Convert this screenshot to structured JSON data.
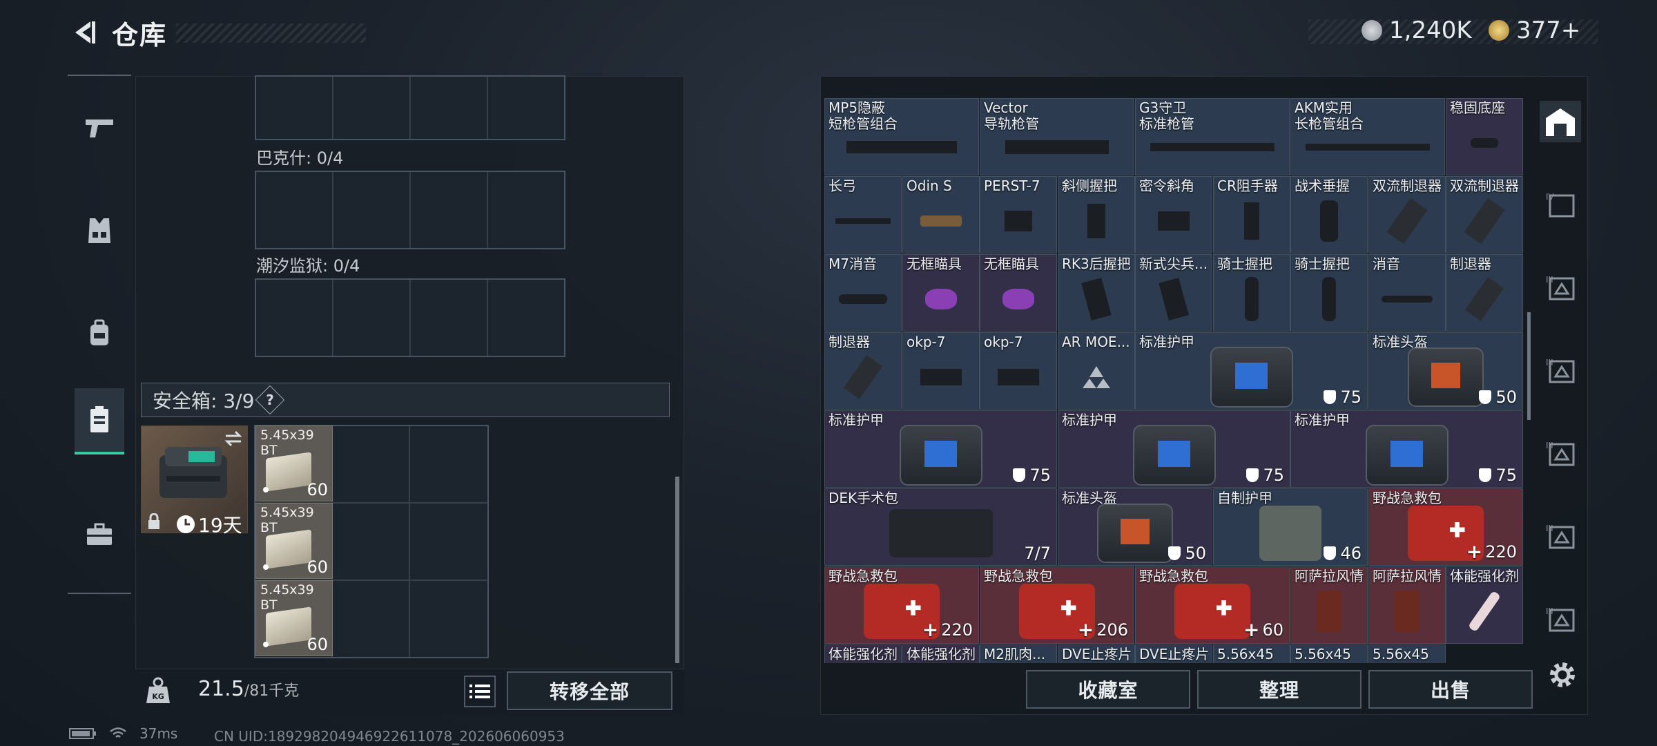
{
  "header": {
    "title": "仓库",
    "currency1": "1,240K",
    "currency2": "377+"
  },
  "left": {
    "slots": [
      {
        "label": "巴克什: 0/4"
      },
      {
        "label": "潮汐监狱: 0/4"
      }
    ],
    "safe_box": {
      "label": "安全箱: 3/9",
      "help": "?",
      "duration": "19天"
    },
    "ammo": [
      {
        "name": "5.45x39",
        "sub": "BT",
        "qty": "60"
      },
      {
        "name": "5.45x39",
        "sub": "BT",
        "qty": "60"
      },
      {
        "name": "5.45x39",
        "sub": "BT",
        "qty": "60"
      }
    ],
    "weight": {
      "current": "21.5",
      "max": "/81千克"
    },
    "transfer_all": "转移全部"
  },
  "inventory": {
    "row1": [
      {
        "l1": "MP5隐蔽",
        "l2": "短枪管组合"
      },
      {
        "l1": "Vector",
        "l2": "导轨枪管"
      },
      {
        "l1": "G3守卫",
        "l2": "标准枪管"
      },
      {
        "l1": "AKM实用",
        "l2": "长枪管组合"
      },
      {
        "l1": "稳固底座",
        "l2": ""
      }
    ],
    "row2": [
      "长弓",
      "Odin S",
      "PERST-7",
      "斜侧握把",
      "密令斜角",
      "CR阻手器",
      "战术垂握",
      "双流制退器",
      "双流制退器"
    ],
    "row3": [
      "M7消音",
      "无框瞄具",
      "无框瞄具",
      "RK3后握把",
      "新式尖兵...",
      "骑士握把",
      "骑士握把",
      "消音",
      "制退器"
    ],
    "row4": {
      "small": [
        "制退器",
        "okp-7",
        "okp-7",
        "AR MOE..."
      ],
      "armor": {
        "label": "标准护甲",
        "val": "75"
      },
      "helmet": {
        "label": "标准头盔",
        "val": "50"
      }
    },
    "row5": [
      {
        "label": "标准护甲",
        "val": "75"
      },
      {
        "label": "标准护甲",
        "val": "75"
      },
      {
        "label": "标准护甲",
        "val": "75"
      }
    ],
    "row6": [
      {
        "label": "DEK手术包",
        "val": "7/7"
      },
      {
        "label": "标准头盔",
        "val": "50"
      },
      {
        "label": "自制护甲",
        "val": "46"
      },
      {
        "label": "野战急救包",
        "val": "220"
      }
    ],
    "row7": {
      "kits": [
        {
          "label": "野战急救包",
          "val": "220"
        },
        {
          "label": "野战急救包",
          "val": "206"
        },
        {
          "label": "野战急救包",
          "val": "60"
        }
      ],
      "small": [
        "阿萨拉风情",
        "阿萨拉风情",
        "体能强化剂"
      ]
    },
    "row8": [
      "体能强化剂",
      "体能强化剂",
      "M2肌肉...",
      "DVE止疼片",
      "DVE止疼片",
      "5.56x45",
      "5.56x45",
      "5.56x45"
    ]
  },
  "buttons": {
    "collection": "收藏室",
    "sort": "整理",
    "sell": "出售"
  },
  "status": {
    "ping": "37ms",
    "uid": "CN UID:189298204946922611078_202606060953"
  },
  "colors": {
    "accent": "#3ac7a2",
    "cell_blue": "#2c3b4f",
    "cell_purple": "#342f48",
    "cell_red": "#5a2f3a"
  }
}
